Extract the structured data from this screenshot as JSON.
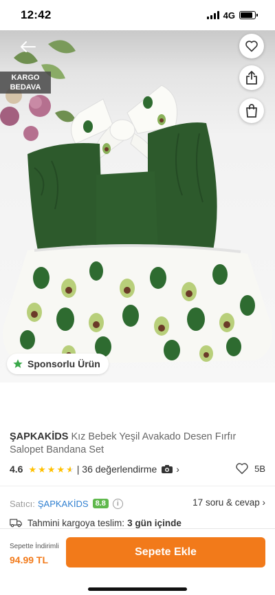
{
  "status_bar": {
    "time": "12:42",
    "network": "4G",
    "battery_percent": 85
  },
  "image": {
    "kargo_badge": [
      "KARGO",
      "BEDAVA"
    ],
    "sponsor_label": "Sponsorlu Ürün"
  },
  "product": {
    "brand": "ŞAPKAKİDS",
    "title": "Kız Bebek Yeşil Avakado Desen Fırfır Salopet Bandana Set",
    "rating": "4.6",
    "stars_filled": 4.6,
    "reviews": "| 36 değerlendirme",
    "favorites": "5B"
  },
  "seller": {
    "label": "Satıcı:",
    "name": "ŞAPKAKİDS",
    "score": "8.8",
    "qa": "17 soru & cevap"
  },
  "shipping": {
    "text": "Tahmini kargoya teslim:",
    "value": "3 gün içinde"
  },
  "bottom": {
    "price_label": "Sepette İndirimli",
    "price": "94.99 TL",
    "add_to_cart": "Sepete Ekle"
  },
  "colors": {
    "accent": "#f27a1a",
    "star": "#ffc000",
    "seller_score": "#5fb84c",
    "link": "#2f7fd0"
  }
}
